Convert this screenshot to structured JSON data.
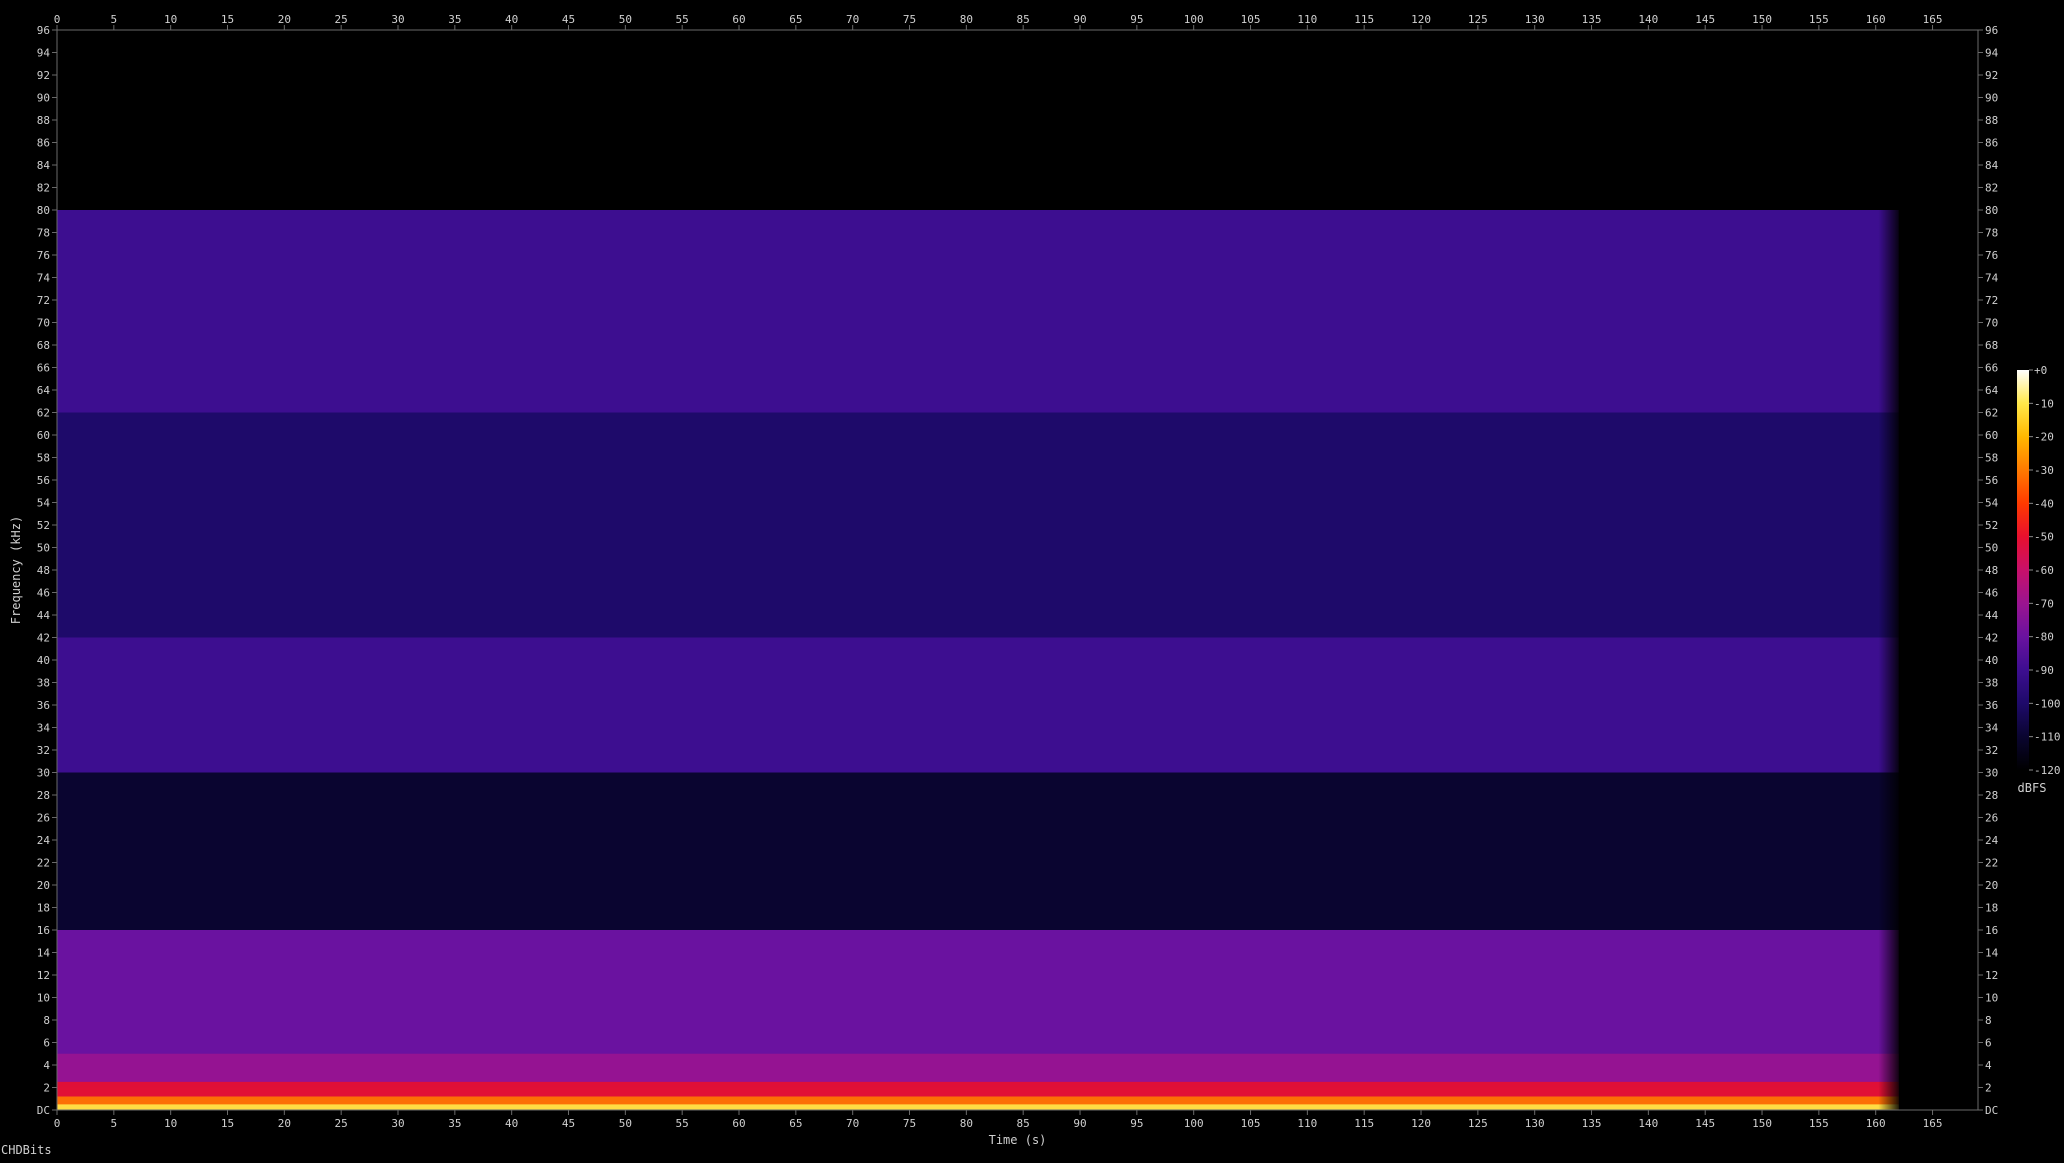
{
  "chart_data": {
    "type": "heatmap",
    "xlabel": "Time (s)",
    "ylabel": "Frequency (kHz)",
    "xlim": [
      0,
      169
    ],
    "ylim": [
      0,
      96
    ],
    "x_ticks": [
      0,
      5,
      10,
      15,
      20,
      25,
      30,
      35,
      40,
      45,
      50,
      55,
      60,
      65,
      70,
      75,
      80,
      85,
      90,
      95,
      100,
      105,
      110,
      115,
      120,
      125,
      130,
      135,
      140,
      145,
      150,
      155,
      160,
      165
    ],
    "y_ticks": [
      "DC",
      "2",
      "4",
      "6",
      "8",
      "10",
      "12",
      "14",
      "16",
      "18",
      "20",
      "22",
      "24",
      "26",
      "28",
      "30",
      "32",
      "34",
      "36",
      "38",
      "40",
      "42",
      "44",
      "46",
      "48",
      "50",
      "52",
      "54",
      "56",
      "58",
      "60",
      "62",
      "64",
      "66",
      "68",
      "70",
      "72",
      "74",
      "76",
      "78",
      "80",
      "82",
      "84",
      "86",
      "88",
      "90",
      "92",
      "94",
      "96"
    ],
    "colorbar": {
      "label": "dBFS",
      "ticks": [
        "+0",
        "-10",
        "-20",
        "-30",
        "-40",
        "-50",
        "-60",
        "-70",
        "-80",
        "-90",
        "-100",
        "-110",
        "-120"
      ],
      "range": [
        -120,
        0
      ],
      "colors": [
        "#000000",
        "#0a0530",
        "#1e0a6a",
        "#3d0e90",
        "#6a12a0",
        "#9a1490",
        "#c8106a",
        "#e8102e",
        "#ff3a00",
        "#ff7a00",
        "#ffb800",
        "#ffe84a",
        "#ffffff"
      ]
    },
    "signal_end_s": 162,
    "bands": [
      {
        "from_khz": 0,
        "to_khz": 2,
        "level_dbfs": -40
      },
      {
        "from_khz": 2,
        "to_khz": 16,
        "level_dbfs": -85
      },
      {
        "from_khz": 16,
        "to_khz": 30,
        "level_dbfs": -108
      },
      {
        "from_khz": 30,
        "to_khz": 42,
        "level_dbfs": -88
      },
      {
        "from_khz": 42,
        "to_khz": 62,
        "level_dbfs": -105
      },
      {
        "from_khz": 62,
        "to_khz": 80,
        "level_dbfs": -95
      },
      {
        "from_khz": 80,
        "to_khz": 96,
        "level_dbfs": -120
      }
    ]
  },
  "watermark": "CHDBits"
}
